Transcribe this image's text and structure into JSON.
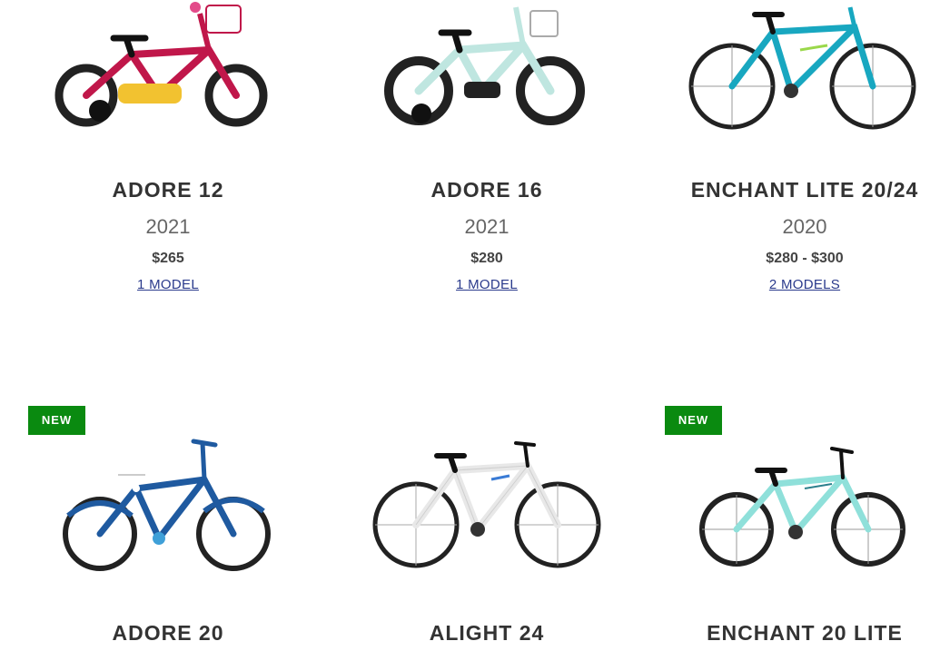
{
  "products": [
    {
      "title": "ADORE 12",
      "year": "2021",
      "price": "$265",
      "models": "1 MODEL",
      "frame_color": "#c0174a",
      "accent_color": "#f2c230"
    },
    {
      "title": "ADORE 16",
      "year": "2021",
      "price": "$280",
      "models": "1 MODEL",
      "frame_color": "#bfe6e0",
      "accent_color": "#222222"
    },
    {
      "title": "ENCHANT LITE 20/24",
      "year": "2020",
      "price": "$280 - $300",
      "models": "2 MODELS",
      "frame_color": "#18a7c0",
      "accent_color": "#9ad84a"
    },
    {
      "title": "ADORE 20",
      "badge": "NEW",
      "frame_color": "#1f5aa0",
      "accent_color": "#3fa0d8"
    },
    {
      "title": "ALIGHT 24",
      "frame_color": "#f4f4f4",
      "accent_color": "#3a7bd5"
    },
    {
      "title": "ENCHANT 20 LITE",
      "badge": "NEW",
      "frame_color": "#8fe0da",
      "accent_color": "#2a7f8c"
    }
  ],
  "colors": {
    "badge_bg": "#0a8a10",
    "link": "#2a3a8c"
  },
  "icons": {
    "product_image": "bicycle-icon"
  }
}
